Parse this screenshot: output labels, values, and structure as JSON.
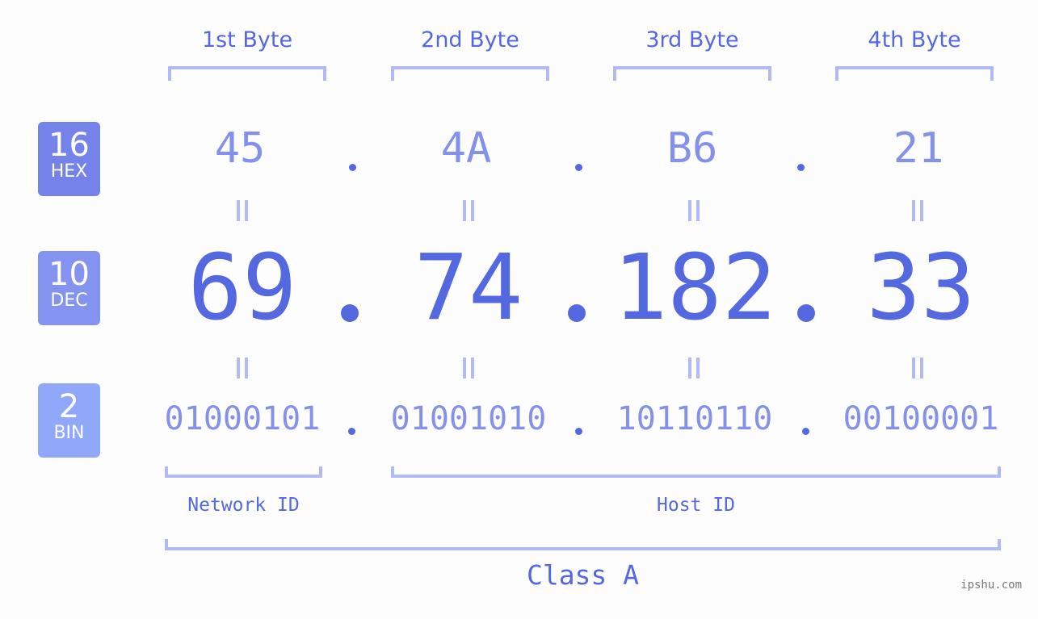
{
  "bytes": {
    "labels": [
      "1st Byte",
      "2nd Byte",
      "3rd Byte",
      "4th Byte"
    ]
  },
  "badges": [
    {
      "num": "16",
      "name": "HEX",
      "color": "#7482ea"
    },
    {
      "num": "10",
      "name": "DEC",
      "color": "#8493f0"
    },
    {
      "num": "2",
      "name": "BIN",
      "color": "#91a8fa"
    }
  ],
  "hex": [
    "45",
    "4A",
    "B6",
    "21"
  ],
  "dec": [
    "69",
    "74",
    "182",
    "33"
  ],
  "bin": [
    "01000101",
    "01001010",
    "10110110",
    "00100001"
  ],
  "ids": {
    "network": "Network ID",
    "host": "Host ID",
    "class": "Class A"
  },
  "watermark": "ipshu.com",
  "colors": {
    "accent": "#5468e0",
    "light": "#8391ea",
    "bracket": "#b1baf5"
  }
}
